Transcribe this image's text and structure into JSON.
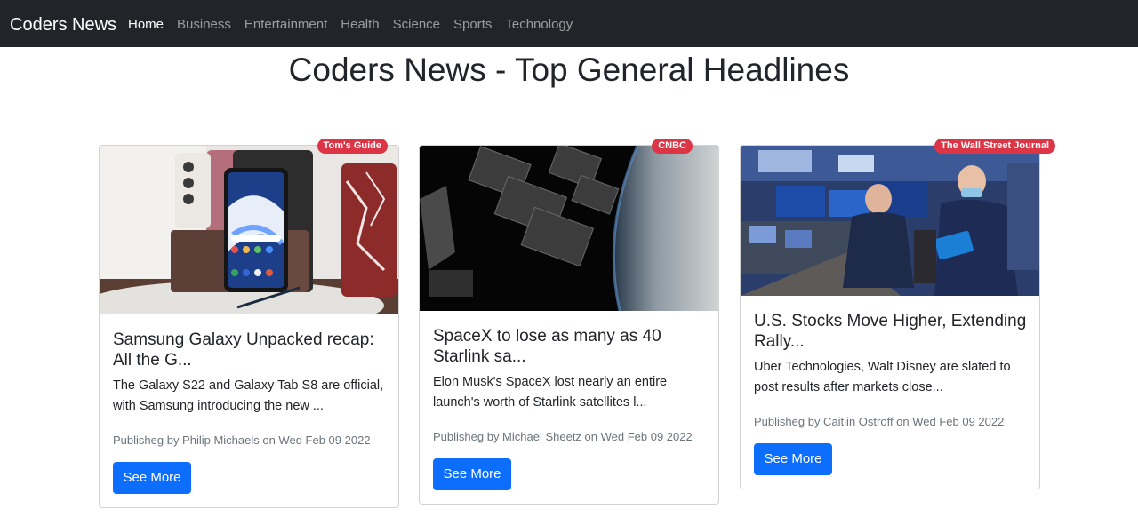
{
  "navbar": {
    "brand": "Coders News",
    "links": [
      "Home",
      "Business",
      "Entertainment",
      "Health",
      "Science",
      "Sports",
      "Technology"
    ],
    "active": "Home"
  },
  "page_title": "Coders News - Top General Headlines",
  "colors": {
    "navbar_bg": "#212529",
    "badge_bg": "#dc3545",
    "button_bg": "#0d6efd"
  },
  "articles": [
    {
      "source": "Tom's Guide",
      "title": "Samsung Galaxy Unpacked recap: All the G...",
      "description": "The Galaxy S22 and Galaxy Tab S8 are official, with Samsung introducing the new ...",
      "meta": "Publisheg by Philip Michaels on Wed Feb 09 2022",
      "button": "See More",
      "image_icon": "smartphone-product-photo"
    },
    {
      "source": "CNBC",
      "title": "SpaceX to lose as many as 40 Starlink sa...",
      "description": "Elon Musk's SpaceX lost nearly an entire launch's worth of Starlink satellites l...",
      "meta": "Publisheg by Michael Sheetz on Wed Feb 09 2022",
      "button": "See More",
      "image_icon": "satellites-over-earth-photo"
    },
    {
      "source": "The Wall Street Journal",
      "title": "U.S. Stocks Move Higher, Extending Rally...",
      "description": "Uber Technologies, Walt Disney are slated to post results after markets close...",
      "meta": "Publisheg by Caitlin Ostroff on Wed Feb 09 2022",
      "button": "See More",
      "image_icon": "stock-exchange-floor-photo"
    }
  ]
}
